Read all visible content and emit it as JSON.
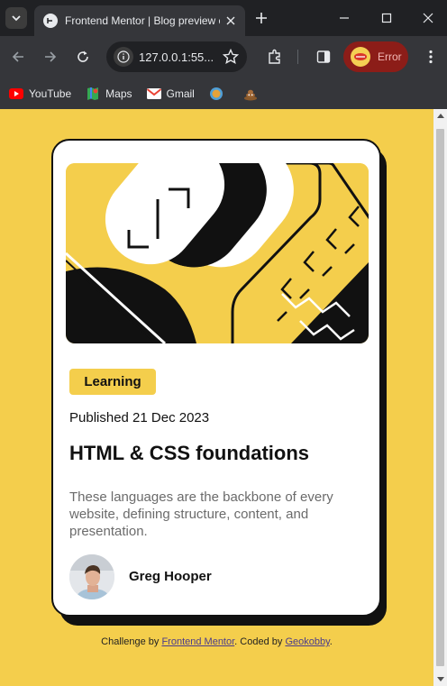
{
  "browser": {
    "tab_title": "Frontend Mentor | Blog preview card",
    "url": "127.0.0.1:55...",
    "profile_status": "Error",
    "bookmarks": [
      {
        "label": "YouTube",
        "icon": "youtube-icon"
      },
      {
        "label": "Maps",
        "icon": "maps-icon"
      },
      {
        "label": "Gmail",
        "icon": "gmail-icon"
      }
    ]
  },
  "card": {
    "tag": "Learning",
    "published": "Published 21 Dec 2023",
    "title": "HTML & CSS foundations",
    "description": "These languages are the backbone of every website, defining structure, content, and presentation.",
    "author": "Greg Hooper"
  },
  "attribution": {
    "prefix": "Challenge by ",
    "challenge_link": "Frontend Mentor",
    "middle": ". Coded by ",
    "coder_link": "Geokobby",
    "suffix": "."
  },
  "colors": {
    "page_background": "#f4ce4c",
    "tag_background": "#f4ce4c",
    "card_background": "#ffffff",
    "text": "#111111",
    "muted_text": "#6b6b6b",
    "error_pill": "#8c1d18"
  }
}
